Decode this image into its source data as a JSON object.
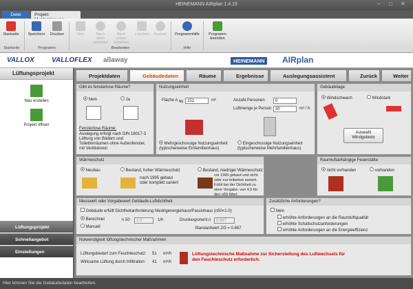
{
  "window": {
    "title": "HEINEMANN AIRplan 1.4.15"
  },
  "ribbon": {
    "tabs": [
      "Datei",
      "Projekt: Musterplanung"
    ],
    "buttons": {
      "startseite": "Startseite",
      "speichern": "Speichern",
      "drucken": "Drucken",
      "neu": "Neu",
      "nach_oben": "Nach oben schieben",
      "nach_unten": "Nach unten schieben",
      "loeschen": "Löschen",
      "suchen": "Suchen",
      "programmhilfe": "Programmhilfe",
      "beenden": "Programm beenden"
    },
    "groups": {
      "startseite": "Startseite",
      "programm": "Programm",
      "bearbeiten": "Bearbeiten",
      "hilfe": "Hilfe"
    }
  },
  "brands": [
    "VALLOX",
    "VALLOFLEX",
    "allaway",
    "HEINEMANN",
    "AIRplan"
  ],
  "left": {
    "title": "Lüftungsprojekt",
    "new": "Neu erstellen",
    "open": "Projekt öffnen",
    "nav": [
      "Lüftungsprojekt",
      "Schnellangebot",
      "Einstellungen"
    ]
  },
  "tabs": [
    "Projektdaten",
    "Gebäudedaten",
    "Räume",
    "Ergebnisse",
    "Auslegungsassistent"
  ],
  "nav_buttons": {
    "back": "Zurück",
    "next": "Weiter"
  },
  "fenster": {
    "title": "Gibt es fensterlose Räume?",
    "nein": "Nein",
    "ja": "Ja",
    "link": "Fensterlose Räume:",
    "note": "Auslegung erfolgt nach DIN 18017-3 Lüftung von Bädern und Toilettenräumen ohne Außenfenster, mit Ventilatoren"
  },
  "nutzung": {
    "title": "Nutzungseinheit",
    "flaeche_label": "Fläche A",
    "flaeche_sub": "NE",
    "flaeche": "151",
    "flaeche_unit": "m²",
    "personen_label": "Anzahl Personen",
    "personen": "0",
    "luft_label": "Luftmenge je Person",
    "luft": "30",
    "luft_unit": "m³ / h",
    "mehr": "Mehrgeschossige Nutzungseinheit (typischerweise Einfamilienhaus)",
    "einge": "Eingeschossige Nutzungseinheit (typischerweise Mehrfamilienhaus)"
  },
  "lage": {
    "title": "Gebäudelage",
    "schwach": "Windschwach",
    "stark": "Windstark",
    "btn": "Auswahl Windgebiete"
  },
  "waerme": {
    "title": "Wärmeschutz",
    "neubau": "Neubau",
    "hoch": "Bestand, hoher Wärmeschutz",
    "niedrig": "Bestand, niedriger Wärmeschutz",
    "text1": "nach 1995 gebaut oder komplett saniert",
    "text2": "vor 1995 gebaut und nicht oder nur teilweise saniert. Fühlt bei der Dichtheit zu einer Vorgabe: von 4,5 für den n50-Wert"
  },
  "feuer": {
    "title": "Raumluftabhängige Feuerstätte",
    "nicht": "nicht vorhanden",
    "vorh": "vorhanden"
  },
  "mess": {
    "title": "Messwert oder Vorgabewert Gebäude-Luftdichtheit",
    "chk": "Gebäude erfüllt Dichtheitanforderung Niedrigenergiehaus/Passivhaus (n50<1.0)",
    "berechnet": "Berechnet",
    "manuell": "Manuell",
    "n50": "n 50",
    "n50v": "1.0",
    "unit": "1/h",
    "druck_label": "Druckexponent n",
    "druck": "0.667",
    "std": "Standardwert 2/3 = 0.667"
  },
  "zus": {
    "title": "Zusätzliche Anforderungen?",
    "nein": "Nein",
    "a": "erhöhte Anforderungen an die Raumluftqualität",
    "b": "erhöhte Schallschutzanforderungen",
    "c": "erhöhte Anforderungen an die Energieeffizienz"
  },
  "notw": {
    "title": "Notwendigkeit lüftungstechnischer Maßnahmen",
    "r1": "Lüftungsbedarf zum Feuchteschutz:",
    "v1": "51",
    "r2": "Wirksame Lüftung durch Infiltration:",
    "v2": "41",
    "unit": "m³/h",
    "msg": "Lüftungstechnische Maßnahme zur Sicherstellung des Luftwechsels für den Feuchteschutz erforderlich."
  },
  "status": "Hier können Sie die Gebäudedaten bearbeiten."
}
